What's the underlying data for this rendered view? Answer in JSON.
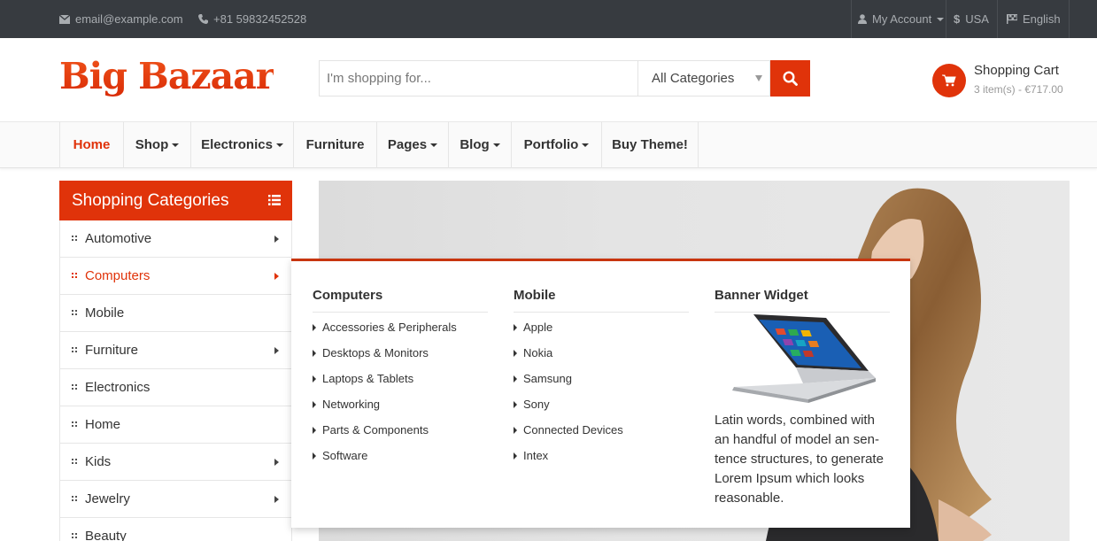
{
  "topbar": {
    "email": "email@example.com",
    "phone": "+81 59832452528",
    "account": "My Account",
    "currency": "USA",
    "language": "English"
  },
  "header": {
    "logo": "Big Bazaar",
    "search_placeholder": "I'm shopping for...",
    "category_select": "All Categories",
    "cart_title": "Shopping Cart",
    "cart_summary": "3 item(s) - €717.00"
  },
  "nav": {
    "items": [
      "Home",
      "Shop",
      "Electronics",
      "Furniture",
      "Pages",
      "Blog",
      "Portfolio",
      "Buy Theme!"
    ]
  },
  "sidebar": {
    "title": "Shopping Categories",
    "items": [
      "Automotive",
      "Computers",
      "Mobile",
      "Furniture",
      "Electronics",
      "Home",
      "Kids",
      "Jewelry",
      "Beauty"
    ]
  },
  "mega_menu": {
    "computers_title": "Computers",
    "computers_links": [
      "Accessories & Peripherals",
      "Desktops & Monitors",
      "Laptops & Tablets",
      "Networking",
      "Parts & Components",
      "Software"
    ],
    "mobile_title": "Mobile",
    "mobile_links": [
      "Apple",
      "Nokia",
      "Samsung",
      "Sony",
      "Connected Devices",
      "Intex"
    ],
    "widget_title": "Banner Widget",
    "widget_text": "Latin words, combined with an handful of model an sen-tence structures, to generate Lorem Ipsum which looks reasonable."
  },
  "colors": {
    "accent": "#e0330a",
    "topbar": "#373b40"
  }
}
